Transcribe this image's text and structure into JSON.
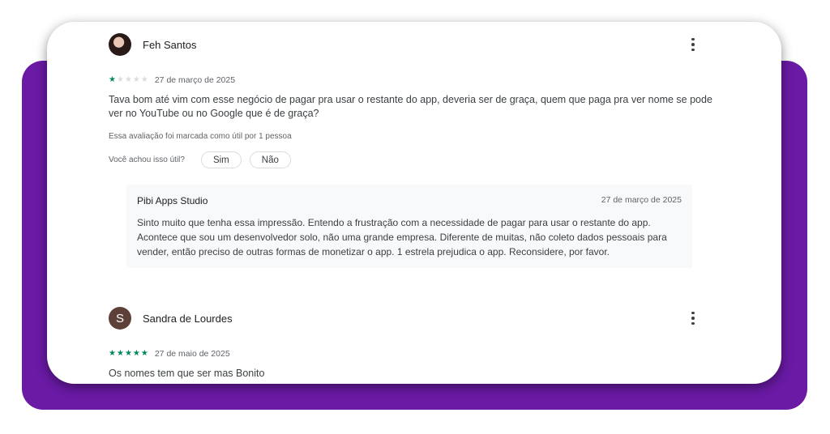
{
  "reviews": [
    {
      "author": "Feh Santos",
      "avatar_type": "photo",
      "rating": 1,
      "max_rating": 5,
      "date": "27 de março de 2025",
      "text": "Tava bom até vim com esse negócio de pagar pra usar o restante do app, deveria ser de graça, quem que paga pra ver nome se pode ver no YouTube ou no Google que é de graça?",
      "helpful_count_text": "Essa avaliação foi marcada como útil por 1 pessoa",
      "helpful_question": "Você achou isso útil?",
      "yes_label": "Sim",
      "no_label": "Não",
      "reply": {
        "developer": "Pibi Apps Studio",
        "date": "27 de março de 2025",
        "text": "Sinto muito que tenha essa impressão. Entendo a frustração com a necessidade de pagar para usar o restante do app. Acontece que sou um desenvolvedor solo, não uma grande empresa. Diferente de muitas, não coleto dados pessoais para vender, então preciso de outras formas de monetizar o app. 1 estrela prejudica o app. Reconsidere, por favor."
      }
    },
    {
      "author": "Sandra de Lourdes",
      "avatar_type": "letter",
      "avatar_letter": "S",
      "rating": 5,
      "max_rating": 5,
      "date": "27 de maio de 2025",
      "text": "Os nomes tem que ser mas Bonito"
    }
  ],
  "icons": {
    "star": "★",
    "more": "more-vert-icon"
  },
  "colors": {
    "star_filled": "#01875f",
    "star_empty": "#dadce0",
    "background_accent": "#6a1aa5"
  }
}
